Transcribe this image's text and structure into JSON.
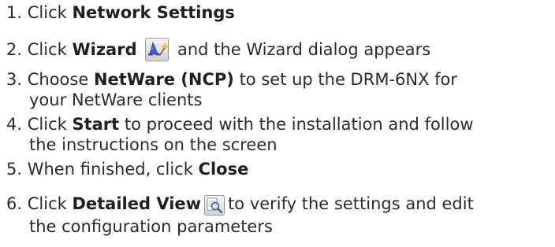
{
  "steps": [
    {
      "number": "1.",
      "pre": "Click",
      "bold": "Network Settings",
      "post": ""
    },
    {
      "number": "2.",
      "pre": "Click",
      "bold": "Wizard",
      "icon": "wizard-icon",
      "post": "and the Wizard dialog appears"
    },
    {
      "number": "3.",
      "pre": "Choose",
      "bold": "NetWare (NCP)",
      "post": "to set up the DRM-6NX for",
      "continuation": "your NetWare clients"
    },
    {
      "number": "4.",
      "pre": "Click",
      "bold": "Start",
      "post": "to proceed with the installation and follow",
      "continuation": "the instructions on the screen"
    },
    {
      "number": "5.",
      "pre": "When finished, click",
      "bold": "Close",
      "post": ""
    },
    {
      "number": "6.",
      "pre": "Click",
      "bold": "Detailed View",
      "icon": "detailed-view-icon",
      "post": "to verify the settings and edit",
      "continuation": "the configuration parameters"
    }
  ],
  "colors": {
    "text": "#2b2b2b",
    "bold_text": "#1f1f1f"
  }
}
